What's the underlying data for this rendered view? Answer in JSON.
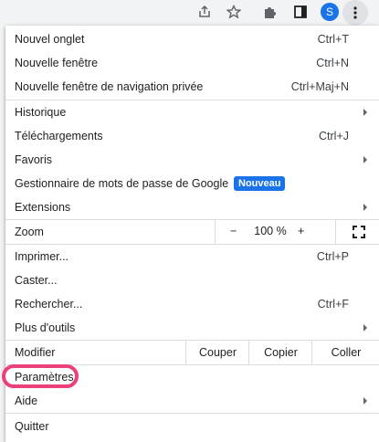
{
  "toolbar": {
    "share_icon": "share-icon",
    "star_icon": "star-icon",
    "extensions_icon": "puzzle-icon",
    "side_panel_icon": "side-panel-icon",
    "avatar_letter": "S",
    "menu_icon": "kebab-menu-icon"
  },
  "menu": {
    "new_tab": {
      "label": "Nouvel onglet",
      "shortcut": "Ctrl+T"
    },
    "new_window": {
      "label": "Nouvelle fenêtre",
      "shortcut": "Ctrl+N"
    },
    "new_incognito": {
      "label": "Nouvelle fenêtre de navigation privée",
      "shortcut": "Ctrl+Maj+N"
    },
    "history": {
      "label": "Historique"
    },
    "downloads": {
      "label": "Téléchargements",
      "shortcut": "Ctrl+J"
    },
    "bookmarks": {
      "label": "Favoris"
    },
    "password_manager": {
      "label": "Gestionnaire de mots de passe de Google",
      "badge": "Nouveau"
    },
    "extensions": {
      "label": "Extensions"
    },
    "zoom": {
      "label": "Zoom",
      "minus": "−",
      "value": "100 %",
      "plus": "+"
    },
    "print": {
      "label": "Imprimer...",
      "shortcut": "Ctrl+P"
    },
    "cast": {
      "label": "Caster..."
    },
    "find": {
      "label": "Rechercher...",
      "shortcut": "Ctrl+F"
    },
    "more_tools": {
      "label": "Plus d'outils"
    },
    "edit": {
      "label": "Modifier",
      "cut": "Couper",
      "copy": "Copier",
      "paste": "Coller"
    },
    "settings": {
      "label": "Paramètres"
    },
    "help": {
      "label": "Aide"
    },
    "quit": {
      "label": "Quitter"
    }
  },
  "colors": {
    "accent": "#1a73e8",
    "highlight": "#ec407a"
  }
}
